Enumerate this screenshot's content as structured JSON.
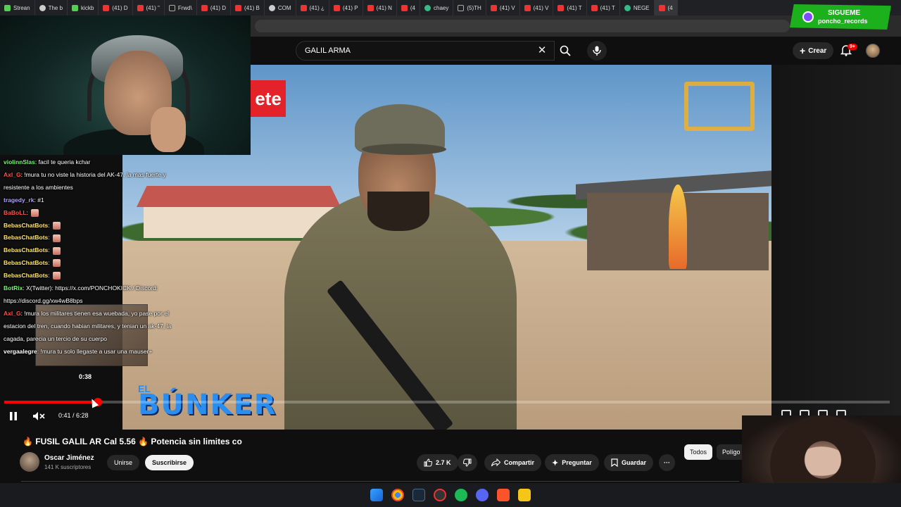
{
  "browser": {
    "tabs": [
      {
        "label": "Strean",
        "icon": "kick-icon"
      },
      {
        "label": "The b",
        "icon": "globe-icon"
      },
      {
        "label": "kickb",
        "icon": "kick-icon"
      },
      {
        "label": "(41) D",
        "icon": "youtube-icon"
      },
      {
        "label": "(41) \"",
        "icon": "youtube-icon"
      },
      {
        "label": "Frwd\\",
        "icon": "x-icon"
      },
      {
        "label": "(41) D",
        "icon": "youtube-icon"
      },
      {
        "label": "(41) B",
        "icon": "youtube-icon"
      },
      {
        "label": "COM",
        "icon": "globe-icon"
      },
      {
        "label": "(41) ¿",
        "icon": "youtube-icon"
      },
      {
        "label": "(41) P",
        "icon": "youtube-icon"
      },
      {
        "label": "(41) N",
        "icon": "youtube-icon"
      },
      {
        "label": "(4",
        "icon": "youtube-icon"
      },
      {
        "label": "chaey",
        "icon": "google-icon"
      },
      {
        "label": "(5)TH",
        "icon": "tiktok-icon"
      },
      {
        "label": "(41) V",
        "icon": "youtube-icon"
      },
      {
        "label": "(41) V",
        "icon": "youtube-icon"
      },
      {
        "label": "(41) T",
        "icon": "youtube-icon"
      },
      {
        "label": "(41) T",
        "icon": "youtube-icon"
      },
      {
        "label": "NEGE",
        "icon": "google-icon"
      },
      {
        "label": "(4",
        "icon": "youtube-icon",
        "active": true
      }
    ]
  },
  "youtube": {
    "search_value": "GALIL ARMA",
    "create_label": "Crear",
    "notifications_badge": "9+"
  },
  "overlay": {
    "sigueme_title": "SIGUEME",
    "sigueme_handle": "poncho_records",
    "banner_text": "ete",
    "bunker_text": "BÚNKER",
    "bunker_prefix": "EL"
  },
  "chat": [
    {
      "user": "violinnSlas",
      "text": ": facil te queria kchar",
      "color": "u-green"
    },
    {
      "user": "Axl_G",
      "text": ": !mura tu no viste la historia del AK-47, la mas fuerte y",
      "color": "u-red"
    },
    {
      "user": "",
      "text": "resistente a los ambientes",
      "color": "u-white"
    },
    {
      "user": "tragedy_rk",
      "text": ": #1",
      "color": "u-violet"
    },
    {
      "user": "BaBoLL",
      "text": ":",
      "color": "u-red",
      "emote": true
    },
    {
      "user": "BebasChatBots",
      "text": ":",
      "color": "u-yellow",
      "emote": true
    },
    {
      "user": "BebasChatBots",
      "text": ":",
      "color": "u-yellow",
      "emote": true
    },
    {
      "user": "BebasChatBots",
      "text": ":",
      "color": "u-yellow",
      "emote": true
    },
    {
      "user": "BebasChatBots",
      "text": ":",
      "color": "u-yellow",
      "emote": true
    },
    {
      "user": "BebasChatBots",
      "text": ":",
      "color": "u-yellow",
      "emote": true
    },
    {
      "user": "BotRix",
      "text": ": X(Twitter): https://x.com/PONCHOKICK / Discord:",
      "color": "u-green"
    },
    {
      "user": "",
      "text": "https://discord.gg/xw4wB8bps",
      "color": "u-white"
    },
    {
      "user": "Axl_G",
      "text": ": !mura los militares tienen esa wuebada, yo pase por el",
      "color": "u-red"
    },
    {
      "user": "",
      "text": "estacion del tren, cuando habian militares, y tenian un ak-47, la",
      "color": "u-white"
    },
    {
      "user": "",
      "text": "cagada, parecia un tercio de su cuerpo",
      "color": "u-white"
    },
    {
      "user": "vergaalegre",
      "text": ": !mura tu solo llegaste a usar una mauser+",
      "color": "u-white"
    }
  ],
  "player": {
    "hover_time": "0:38",
    "current_time": "0:41 / 6:28",
    "progress": 0.1057
  },
  "video": {
    "title_pre": "🔥",
    "title": "FUSIL GALIL AR Cal 5.56",
    "title_mid": "🔥",
    "title_post": "Potencia sin limites co",
    "channel_name": "Oscar Jiménez",
    "subscribers": "141 K suscriptores",
    "join_label": "Unirse",
    "subscribe_label": "Suscribirse",
    "likes": "2.7 K",
    "share_label": "Compartir",
    "ask_label": "Preguntar",
    "save_label": "Guardar",
    "more_label": "···"
  },
  "chips": {
    "all": "Todos",
    "second": "Polígo"
  },
  "colors": {
    "accent_red": "#ff0000",
    "subscribe_bg": "#f1f1f1",
    "sigueme_green": "#1db01d",
    "bunker_blue": "#2a8ef0"
  }
}
